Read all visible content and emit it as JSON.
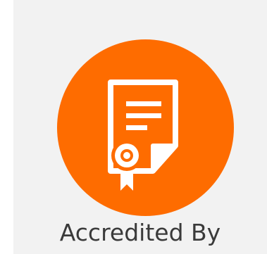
{
  "tile": {
    "caption": "Accredited By",
    "icon": "certificate-icon"
  },
  "colors": {
    "background": "#f2f2f2",
    "badge": "#fe6c00",
    "icon": "#ffffff",
    "caption": "#3a3a3a"
  }
}
